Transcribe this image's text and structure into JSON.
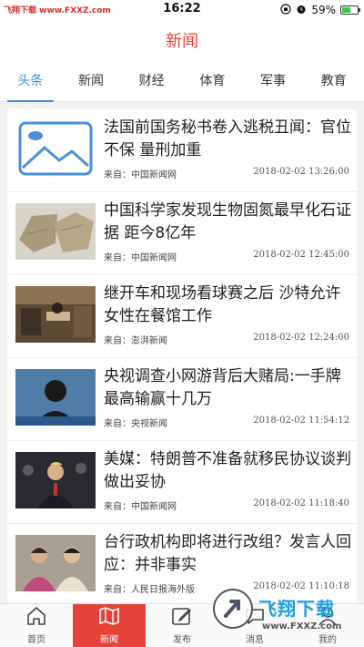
{
  "status": {
    "watermark": "飞翔下载 www.FXXZ.com",
    "time": "16:22",
    "battery": "59%",
    "battery_level": 0.59
  },
  "nav": {
    "title": "新闻"
  },
  "tabs": [
    {
      "label": "头条",
      "active": true
    },
    {
      "label": "新闻",
      "active": false
    },
    {
      "label": "财经",
      "active": false
    },
    {
      "label": "体育",
      "active": false
    },
    {
      "label": "军事",
      "active": false
    },
    {
      "label": "教育",
      "active": false
    }
  ],
  "news": [
    {
      "title": "法国前国务秘书卷入逃税丑闻：官位不保 量刑加重",
      "source": "来自：中国新闻网",
      "time": "2018-02-02 13:26:00",
      "thumb": "placeholder-image-icon"
    },
    {
      "title": "中国科学家发现生物固氮最早化石证据 距今8亿年",
      "source": "来自：中国新闻网",
      "time": "2018-02-02 12:45:00",
      "thumb": "rock-fossil-photo"
    },
    {
      "title": "继开车和现场看球赛之后 沙特允许女性在餐馆工作",
      "source": "来自：澎湃新闻",
      "time": "2018-02-02 12:24:00",
      "thumb": "restaurant-photo"
    },
    {
      "title": "央视调查小网游背后大赌局:一手牌最高输赢十几万",
      "source": "来自：央视新闻",
      "time": "2018-02-02 11:54:12",
      "thumb": "silhouette-interview-photo"
    },
    {
      "title": "美媒：特朗普不准备就移民协议谈判做出妥协",
      "source": "来自：中国新闻网",
      "time": "2018-02-02 11:18:40",
      "thumb": "speech-photo"
    },
    {
      "title": "台行政机构即将进行改组？发言人回应：并非事实",
      "source": "来自：人民日报海外版",
      "time": "2018-02-02 11:10:18",
      "thumb": "people-photo"
    }
  ],
  "bottom_tabs": [
    {
      "label": "首页",
      "icon": "home-icon",
      "active": false
    },
    {
      "label": "新闻",
      "icon": "newspaper-icon",
      "active": true
    },
    {
      "label": "发布",
      "icon": "compose-icon",
      "active": false
    },
    {
      "label": "消息",
      "icon": "message-icon",
      "active": false
    },
    {
      "label": "我的",
      "icon": "user-icon",
      "active": false
    }
  ],
  "watermark": {
    "brand": "飞翔下载",
    "url": "www.FXXZ.com"
  },
  "colors": {
    "accent_red": "#e5433a",
    "tab_blue": "#3a8fd9"
  }
}
